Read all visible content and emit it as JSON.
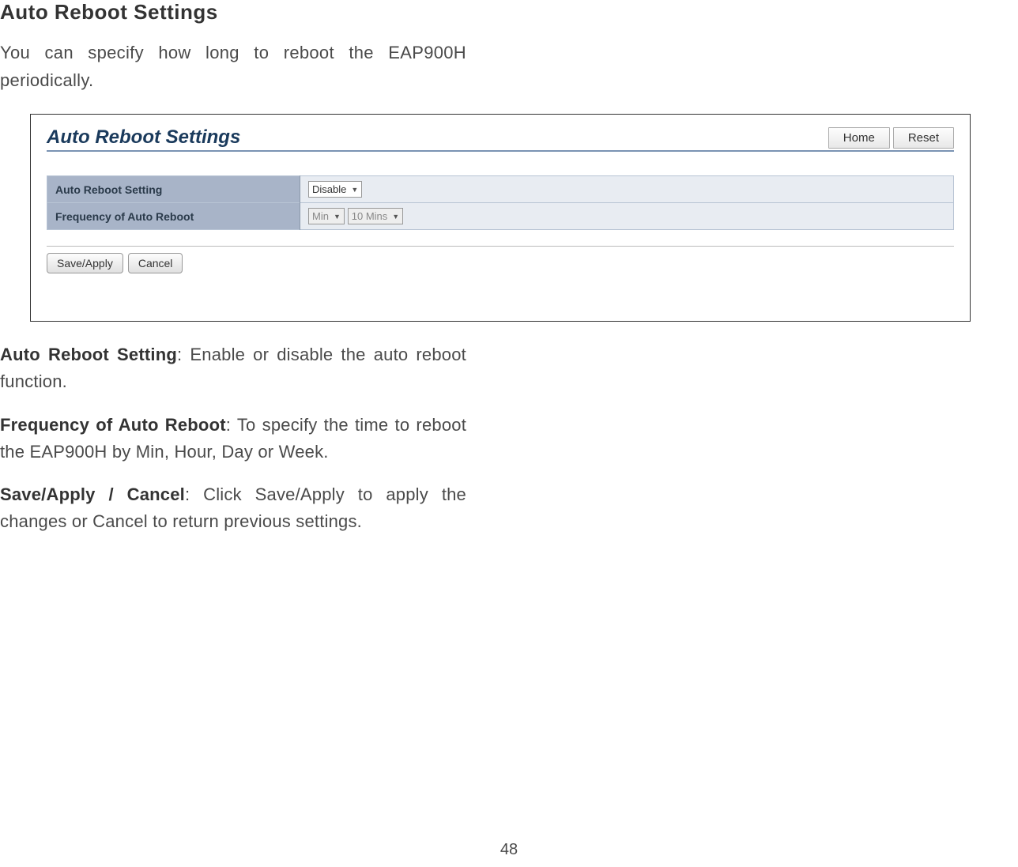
{
  "heading": "Auto Reboot Settings",
  "intro": "You can specify how long to reboot the EAP900H periodically.",
  "panel": {
    "title": "Auto Reboot Settings",
    "home_btn": "Home",
    "reset_btn": "Reset",
    "rows": {
      "setting_label": "Auto Reboot Setting",
      "setting_value": "Disable",
      "freq_label": "Frequency of Auto Reboot",
      "freq_unit": "Min",
      "freq_value": "10 Mins"
    },
    "save_btn": "Save/Apply",
    "cancel_btn": "Cancel"
  },
  "descriptions": {
    "d1_bold": "Auto Reboot Setting",
    "d1_text": ": Enable or disable the auto reboot function.",
    "d2_bold": "Frequency of Auto Reboot",
    "d2_text": ": To specify the time to reboot the EAP900H by Min, Hour, Day or Week.",
    "d3_bold": "Save/Apply / Cancel",
    "d3_text": ": Click Save/Apply to apply the changes or Cancel to return previous settings."
  },
  "page_number": "48"
}
